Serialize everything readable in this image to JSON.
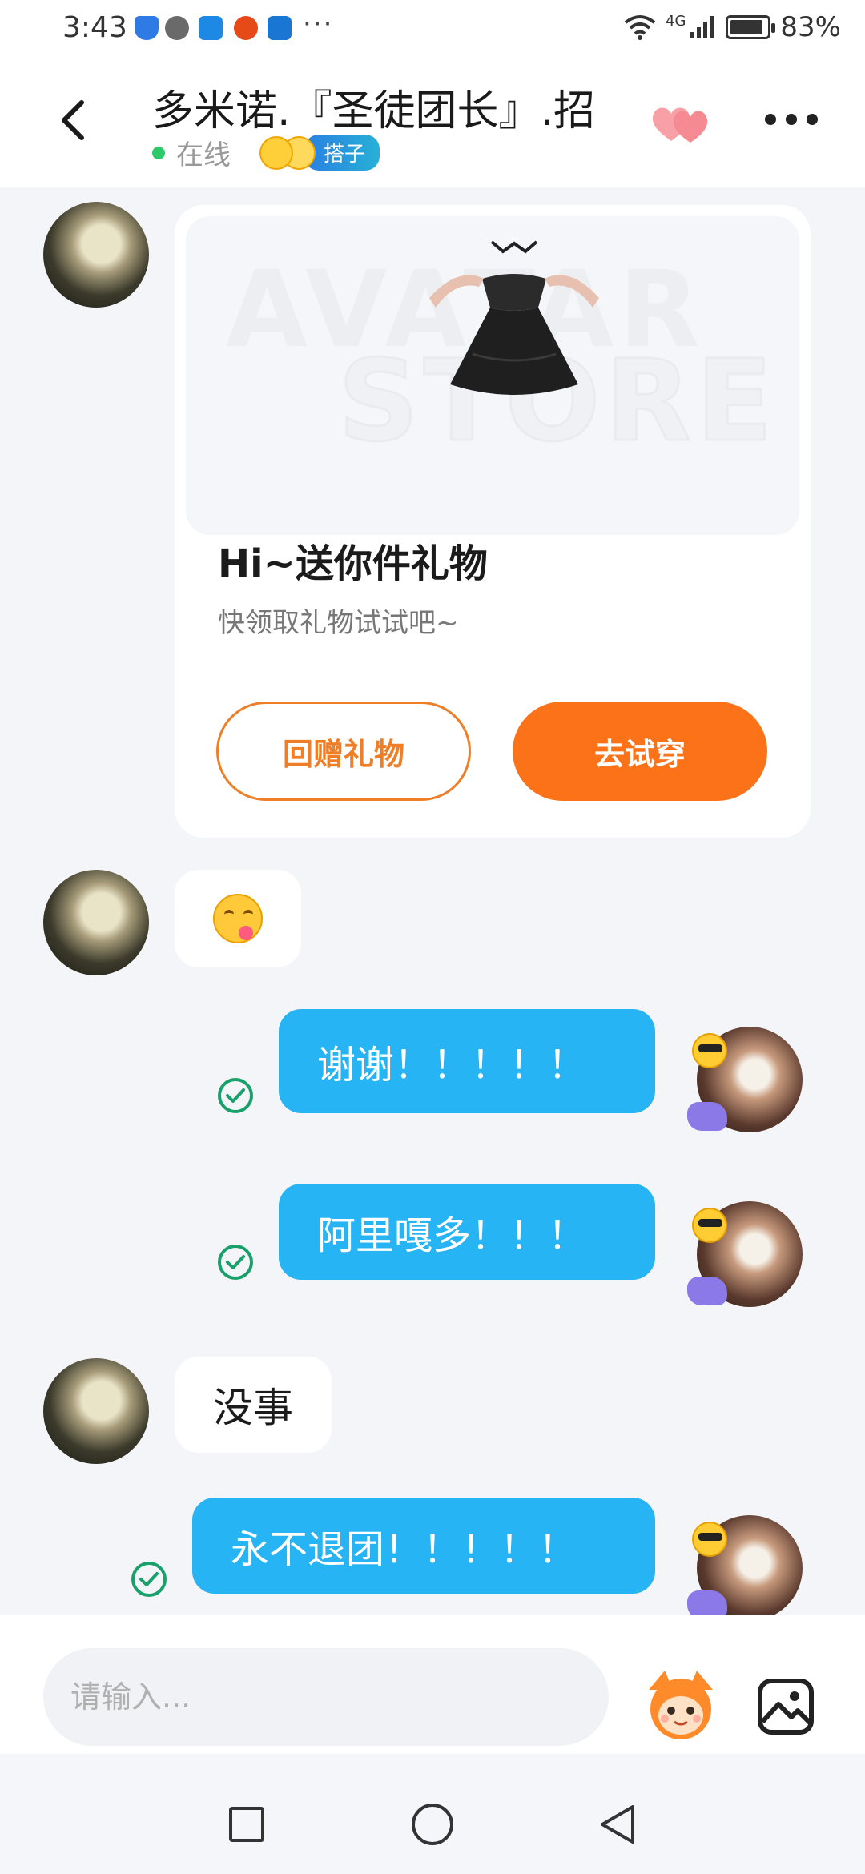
{
  "status_bar": {
    "time": "3:43",
    "dots": "···",
    "signal": "4G",
    "battery": "83%"
  },
  "header": {
    "title": "多米诺.『圣徒团长』.招",
    "status": "在线",
    "tag": "搭子"
  },
  "gift_card": {
    "watermark_top": "AVATAR",
    "watermark_bottom": "STORE",
    "title": "Hi~送你件礼物",
    "subtitle": "快领取礼物试试吧~",
    "return_gift_label": "回赠礼物",
    "try_on_label": "去试穿"
  },
  "messages": [
    {
      "side": "in",
      "type": "emoji",
      "icon": "yum-emoji-icon"
    },
    {
      "side": "out",
      "text": "谢谢！！！！！",
      "status": "read"
    },
    {
      "side": "out",
      "text": "阿里嘎多！！！",
      "status": "read"
    },
    {
      "side": "in",
      "text": "没事"
    },
    {
      "side": "out",
      "text": "永不退团！！！！！",
      "status": "read"
    }
  ],
  "input": {
    "placeholder": "请输入..."
  },
  "colors": {
    "accent_orange": "#fb7218",
    "bubble_blue": "#26b4f5",
    "online_green": "#2cc96b",
    "read_check": "#1aa06b"
  }
}
